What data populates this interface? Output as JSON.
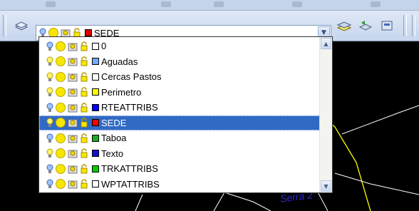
{
  "toolbar": {
    "combo_selected": {
      "label": "SEDE",
      "color": "#e00000"
    },
    "dropdown_icon": "chevron-down-icon"
  },
  "layers": [
    {
      "label": "0",
      "color": "#ffffff",
      "bulb": "blue"
    },
    {
      "label": "Aguadas",
      "color": "#73a9ff",
      "bulb": "yellow"
    },
    {
      "label": "Cercas Pastos",
      "color": "#ffffff",
      "bulb": "yellow"
    },
    {
      "label": "Perimetro",
      "color": "#ffff00",
      "bulb": "yellow"
    },
    {
      "label": "RTEATTRIBS",
      "color": "#0000ff",
      "bulb": "blue"
    },
    {
      "label": "SEDE",
      "color": "#ff0000",
      "bulb": "yellow",
      "selected": true
    },
    {
      "label": "Taboa",
      "color": "#22aa22",
      "bulb": "blue"
    },
    {
      "label": "Texto",
      "color": "#1010d0",
      "bulb": "yellow"
    },
    {
      "label": "TRKATTRIBS",
      "color": "#00cc00",
      "bulb": "blue"
    },
    {
      "label": "WPTATTRIBS",
      "color": "#ffffff",
      "bulb": "blue"
    }
  ],
  "drawing": {
    "caption": "Serra 2",
    "line_color": "#ffff00"
  }
}
